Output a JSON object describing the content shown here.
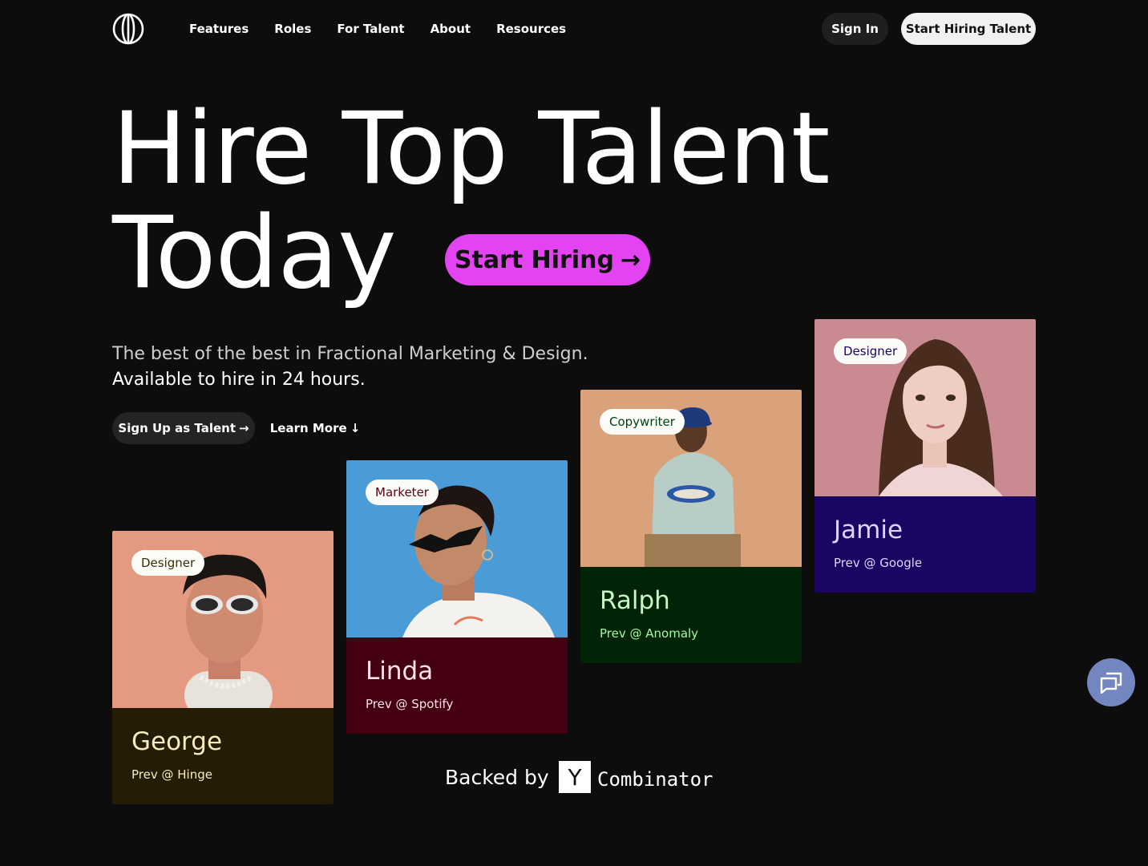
{
  "nav": {
    "logo_icon": "globe-lines-icon",
    "links": [
      "Features",
      "Roles",
      "For Talent",
      "About",
      "Resources"
    ],
    "sign_in": "Sign In",
    "start_hiring_talent": "Start Hiring Talent"
  },
  "hero": {
    "line1": "Hire Top Talent",
    "line2": "Today",
    "cta": "Start Hiring",
    "cta_arrow": "→",
    "cta_color": "#e443f2",
    "subtitle1": "The best of the best in Fractional Marketing & Design.",
    "subtitle2": "Available to hire in 24 hours.",
    "signup": "Sign Up as Talent",
    "signup_arrow": "→",
    "learn_more": "Learn More",
    "learn_arrow": "↓"
  },
  "cards": [
    {
      "role": "Designer",
      "name": "George",
      "prev": "Prev @ Hinge",
      "bg": "#241c05",
      "text": "#f7eac1",
      "photo_bg": "#e49a80"
    },
    {
      "role": "Marketer",
      "name": "Linda",
      "prev": "Prev @ Spotify",
      "bg": "#440010",
      "text": "#ffe0e6",
      "photo_bg": "#4b9bd6"
    },
    {
      "role": "Copywriter",
      "name": "Ralph",
      "prev": "Prev @ Anomaly",
      "bg": "#012407",
      "text": "#c6f7c4",
      "photo_bg": "#d9a27a"
    },
    {
      "role": "Designer",
      "name": "Jamie",
      "prev": "Prev @ Google",
      "bg": "#1b0563",
      "text": "#dcd5ff",
      "photo_bg": "#c98a92"
    }
  ],
  "backed": {
    "label": "Backed by",
    "yc_letter": "Y",
    "yc_word": "Combinator"
  },
  "chat": {
    "icon": "chat-bubbles-icon",
    "color": "#7486bf"
  }
}
